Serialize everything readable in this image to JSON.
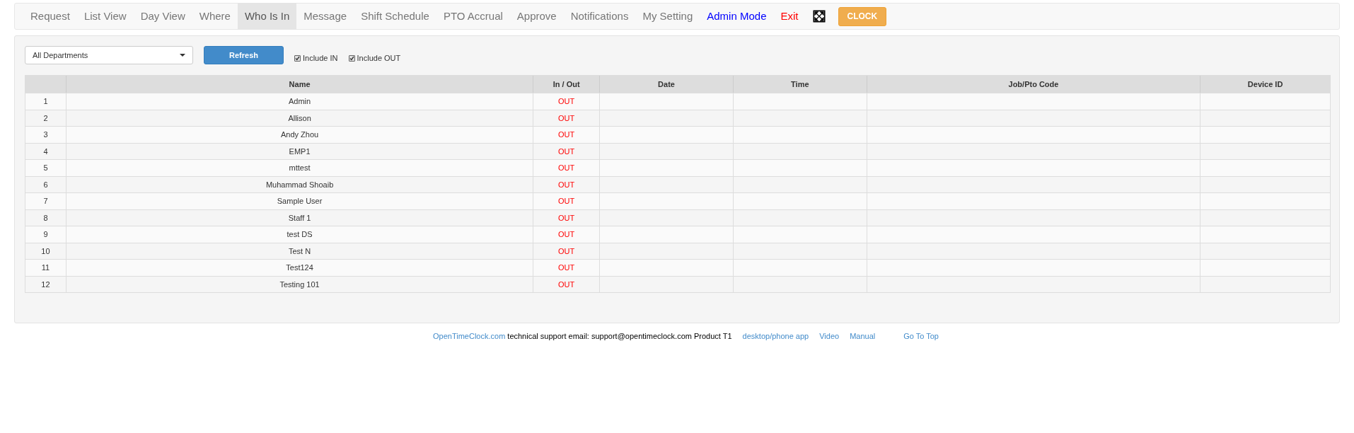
{
  "nav": {
    "items": [
      {
        "label": "Request",
        "kind": "tab",
        "selected": false
      },
      {
        "label": "List View",
        "kind": "tab",
        "selected": false
      },
      {
        "label": "Day View",
        "kind": "tab",
        "selected": false
      },
      {
        "label": "Where",
        "kind": "tab",
        "selected": false
      },
      {
        "label": "Who Is In",
        "kind": "tab",
        "selected": true
      },
      {
        "label": "Message",
        "kind": "tab",
        "selected": false
      },
      {
        "label": "Shift Schedule",
        "kind": "tab",
        "selected": false
      },
      {
        "label": "PTO Accrual",
        "kind": "tab",
        "selected": false
      },
      {
        "label": "Approve",
        "kind": "tab",
        "selected": false
      },
      {
        "label": "Notifications",
        "kind": "tab",
        "selected": false
      },
      {
        "label": "My Setting",
        "kind": "tab",
        "selected": false
      },
      {
        "label": "Admin Mode",
        "kind": "admin",
        "selected": false
      },
      {
        "label": "Exit",
        "kind": "exit",
        "selected": false
      },
      {
        "kind": "fullscreen",
        "selected": false
      },
      {
        "label": "CLOCK",
        "kind": "clock",
        "selected": false
      }
    ]
  },
  "filters": {
    "department": "All Departments",
    "refresh": "Refresh",
    "checks": [
      {
        "label": "Include IN",
        "checked": true
      },
      {
        "label": "Include OUT",
        "checked": true
      }
    ]
  },
  "table": {
    "columns": [
      "",
      "Name",
      "In / Out",
      "Date",
      "Time",
      "Job/Pto Code",
      "Device ID"
    ],
    "rows": [
      {
        "index": "1",
        "name": "Admin",
        "status": "OUT"
      },
      {
        "index": "2",
        "name": "Allison",
        "status": "OUT"
      },
      {
        "index": "3",
        "name": "Andy Zhou",
        "status": "OUT"
      },
      {
        "index": "4",
        "name": "EMP1",
        "status": "OUT"
      },
      {
        "index": "5",
        "name": "mttest",
        "status": "OUT"
      },
      {
        "index": "6",
        "name": "Muhammad Shoaib",
        "status": "OUT"
      },
      {
        "index": "7",
        "name": "Sample User",
        "status": "OUT"
      },
      {
        "index": "8",
        "name": "Staff 1",
        "status": "OUT"
      },
      {
        "index": "9",
        "name": "test DS",
        "status": "OUT"
      },
      {
        "index": "10",
        "name": "Test N",
        "status": "OUT"
      },
      {
        "index": "11",
        "name": "Test124",
        "status": "OUT"
      },
      {
        "index": "12",
        "name": "Testing 101",
        "status": "OUT"
      }
    ]
  },
  "footer": {
    "site_link": "OpenTimeClock.com",
    "support_text": "technical support email: support@opentimeclock.com Product T1",
    "links": [
      "desktop/phone app",
      "Video",
      "Manual"
    ],
    "top_link": "Go To Top"
  }
}
